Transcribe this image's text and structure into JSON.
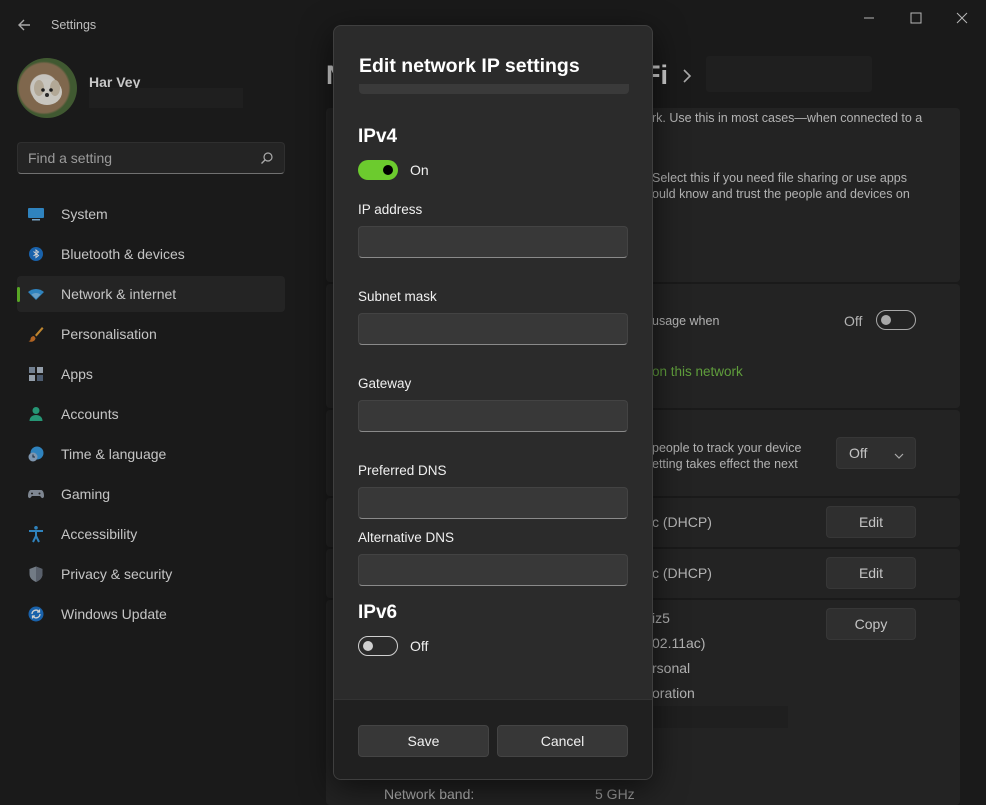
{
  "window": {
    "title": "Settings"
  },
  "user": {
    "name": "Har Vey"
  },
  "search": {
    "placeholder": "Find a setting"
  },
  "sidebar": {
    "items": [
      {
        "label": "System",
        "icon": "monitor-icon",
        "active": false
      },
      {
        "label": "Bluetooth & devices",
        "icon": "bluetooth-icon",
        "active": false
      },
      {
        "label": "Network & internet",
        "icon": "wifi-icon",
        "active": true
      },
      {
        "label": "Personalisation",
        "icon": "paintbrush-icon",
        "active": false
      },
      {
        "label": "Apps",
        "icon": "apps-icon",
        "active": false
      },
      {
        "label": "Accounts",
        "icon": "person-icon",
        "active": false
      },
      {
        "label": "Time & language",
        "icon": "clock-globe-icon",
        "active": false
      },
      {
        "label": "Gaming",
        "icon": "gamepad-icon",
        "active": false
      },
      {
        "label": "Accessibility",
        "icon": "accessibility-icon",
        "active": false
      },
      {
        "label": "Privacy & security",
        "icon": "shield-icon",
        "active": false
      },
      {
        "label": "Windows Update",
        "icon": "update-icon",
        "active": false
      }
    ]
  },
  "background": {
    "heading_initial": "N",
    "heading_tail": "Fi",
    "public_desc": "rk. Use this in most cases—when connected to a",
    "private_desc_1": "Select this if you need file sharing or use apps",
    "private_desc_2": "ould know and trust the people and devices on",
    "metered_text": "usage when",
    "metered_state": "Off",
    "data_limit_link": "on this network",
    "random_hw_1": "people to track your device",
    "random_hw_2": "etting takes effect the next",
    "random_hw_value": "Off",
    "ip_assignment": "c (DHCP)",
    "dns_assignment": "c (DHCP)",
    "edit_label": "Edit",
    "copy_label": "Copy",
    "prop_ssid": "iz5",
    "prop_protocol": "02.11ac)",
    "prop_security": "rsonal",
    "prop_manufacturer": "oration",
    "prop_band_label": "Network band:",
    "prop_band_value": "5 GHz"
  },
  "dialog": {
    "title": "Edit network IP settings",
    "ipv4": {
      "heading": "IPv4",
      "toggle_state": "On",
      "fields": [
        {
          "label": "IP address",
          "value": ""
        },
        {
          "label": "Subnet mask",
          "value": ""
        },
        {
          "label": "Gateway",
          "value": ""
        },
        {
          "label": "Preferred DNS",
          "value": ""
        },
        {
          "label": "Alternative DNS",
          "value": ""
        }
      ]
    },
    "ipv6": {
      "heading": "IPv6",
      "toggle_state": "Off"
    },
    "save_label": "Save",
    "cancel_label": "Cancel"
  },
  "colors": {
    "accent": "#6ccb2e",
    "link": "#75c04a",
    "window_bg": "#202020",
    "dialog_bg": "#2b2b2b"
  }
}
